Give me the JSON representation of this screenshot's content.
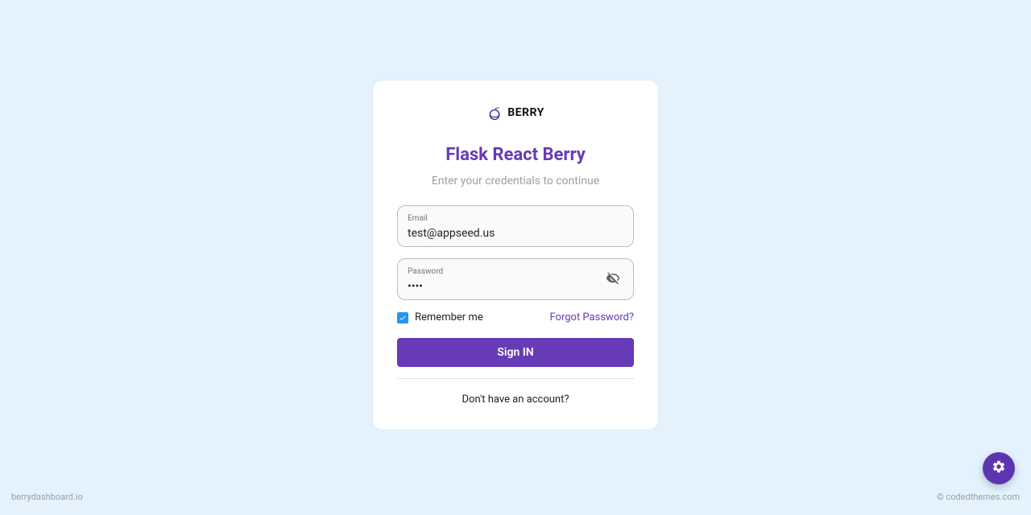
{
  "brand": {
    "name": "BERRY"
  },
  "header": {
    "title": "Flask React Berry",
    "subtitle": "Enter your credentials to continue"
  },
  "form": {
    "email_label": "Email",
    "email_value": "test@appseed.us",
    "password_label": "Password",
    "password_value": "••••",
    "remember_label": "Remember me",
    "remember_checked": true,
    "forgot_label": "Forgot Password?",
    "signin_label": "Sign IN",
    "signup_label": "Don't have an account?"
  },
  "footer": {
    "left": "berrydashboard.io",
    "right": "© codedthemes.com"
  },
  "colors": {
    "accent": "#673ab7",
    "bg": "#e3f2fd",
    "checkbox": "#2196f3"
  }
}
